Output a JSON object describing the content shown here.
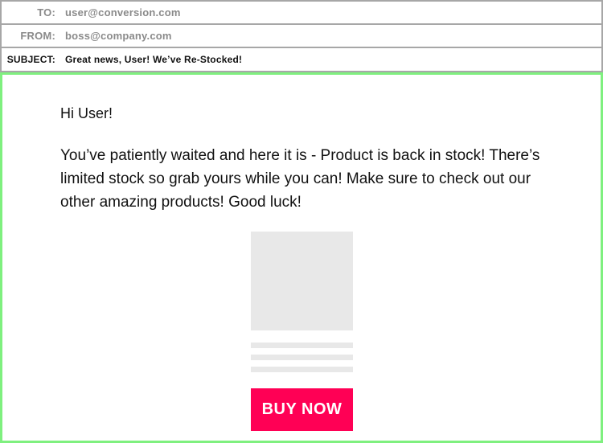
{
  "header": {
    "to_label": "TO:",
    "to_value": "user@conversion.com",
    "from_label": "FROM:",
    "from_value": "boss@company.com",
    "subject_label": "SUBJECT:",
    "subject_value": "Great news, User! We’ve Re-Stocked!"
  },
  "body": {
    "greeting": "Hi User!",
    "message": "You’ve patiently waited and here it is - Product is back in stock! There’s limited stock so grab yours while you can! Make sure to check out our other amazing products! Good luck!",
    "buy_button_label": "BUY NOW"
  },
  "colors": {
    "body_border": "#7ff07f",
    "header_border": "#a7a7a7",
    "button_bg": "#ff0055",
    "placeholder": "#e8e8e8"
  }
}
